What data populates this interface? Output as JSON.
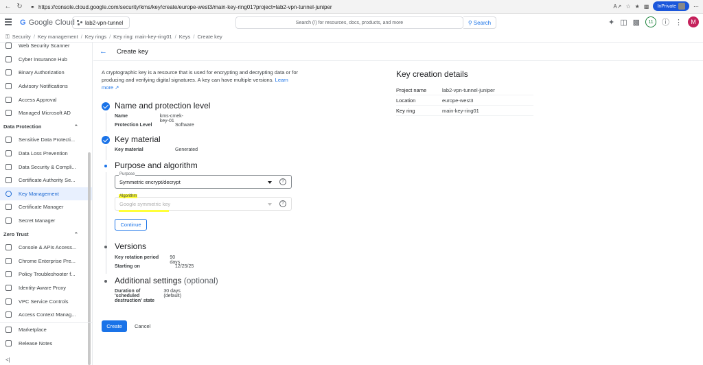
{
  "browser": {
    "url": "https://console.cloud.google.com/security/kms/key/create/europe-west3/main-key-ring01?project=lab2-vpn-tunnel-juniper",
    "inprivate_label": "InPrivate"
  },
  "header": {
    "logo_text": "Google Cloud",
    "project": "lab2-vpn-tunnel",
    "search_placeholder": "Search (/) for resources, docs, products, and more",
    "search_button": "Search",
    "notification_count": "11",
    "user_initial": "M"
  },
  "breadcrumb": [
    "Security",
    "Key management",
    "Key rings",
    "Key ring: main-key-ring01",
    "Keys",
    "Create key"
  ],
  "sidebar": {
    "items_top": [
      {
        "label": "Web Security Scanner",
        "icon": "shield-icon"
      },
      {
        "label": "Cyber Insurance Hub",
        "icon": "briefcase-icon"
      },
      {
        "label": "Binary Authorization",
        "icon": "grid-icon"
      },
      {
        "label": "Advisory Notifications",
        "icon": "notification-icon"
      },
      {
        "label": "Access Approval",
        "icon": "check-circle-icon"
      },
      {
        "label": "Managed Microsoft AD",
        "icon": "directory-icon"
      }
    ],
    "section_data_protection": "Data Protection",
    "items_dp": [
      {
        "label": "Sensitive Data Protecti...",
        "icon": "search-icon"
      },
      {
        "label": "Data Loss Prevention",
        "icon": "dlp-icon"
      },
      {
        "label": "Data Security & Compli...",
        "icon": "shield-icon"
      },
      {
        "label": "Certificate Authority Se...",
        "icon": "certificate-icon"
      },
      {
        "label": "Key Management",
        "icon": "key-icon",
        "active": true
      },
      {
        "label": "Certificate Manager",
        "icon": "certificate-icon"
      },
      {
        "label": "Secret Manager",
        "icon": "secret-icon"
      }
    ],
    "section_zero_trust": "Zero Trust",
    "items_zt": [
      {
        "label": "Console & APIs Access...",
        "icon": "console-icon"
      },
      {
        "label": "Chrome Enterprise Pre...",
        "icon": "chrome-icon"
      },
      {
        "label": "Policy Troubleshooter f...",
        "icon": "wrench-icon"
      },
      {
        "label": "Identity-Aware Proxy",
        "icon": "proxy-icon"
      },
      {
        "label": "VPC Service Controls",
        "icon": "vpc-icon"
      },
      {
        "label": "Access Context Manag...",
        "icon": "access-icon"
      }
    ],
    "items_bottom": [
      {
        "label": "Marketplace",
        "icon": "cart-icon"
      },
      {
        "label": "Release Notes",
        "icon": "notes-icon"
      }
    ],
    "collapse_icon": "<|"
  },
  "page": {
    "title": "Create key",
    "intro": "A cryptographic key is a resource that is used for encrypting and decrypting data or for producing and verifying digital signatures. A key can have multiple versions.",
    "learn_more": "Learn more",
    "steps": {
      "name": {
        "title": "Name and protection level",
        "name_label": "Name",
        "name_value": "kms-cmek-key-01",
        "prot_label": "Protection Level",
        "prot_value": "Software"
      },
      "material": {
        "title": "Key material",
        "label": "Key material",
        "value": "Generated"
      },
      "purpose": {
        "title": "Purpose and algorithm",
        "purpose_label": "Purpose",
        "purpose_value": "Symmetric encrypt/decrypt",
        "algorithm_label": "Algorithm",
        "algorithm_value": "Google symmetric key",
        "continue": "Continue"
      },
      "versions": {
        "title": "Versions",
        "rot_label": "Key rotation period",
        "rot_value": "90 days",
        "start_label": "Starting on",
        "start_value": "12/25/25"
      },
      "additional": {
        "title": "Additional settings",
        "optional": "(optional)",
        "dur_label_1": "Duration of 'scheduled",
        "dur_label_2": "destruction' state",
        "dur_value": "30 days (default)"
      }
    },
    "create_button": "Create",
    "cancel_button": "Cancel"
  },
  "details": {
    "title": "Key creation details",
    "rows": [
      {
        "k": "Project name",
        "v": "lab2-vpn-tunnel-juniper"
      },
      {
        "k": "Location",
        "v": "europe-west3"
      },
      {
        "k": "Key ring",
        "v": "main-key-ring01"
      }
    ]
  }
}
